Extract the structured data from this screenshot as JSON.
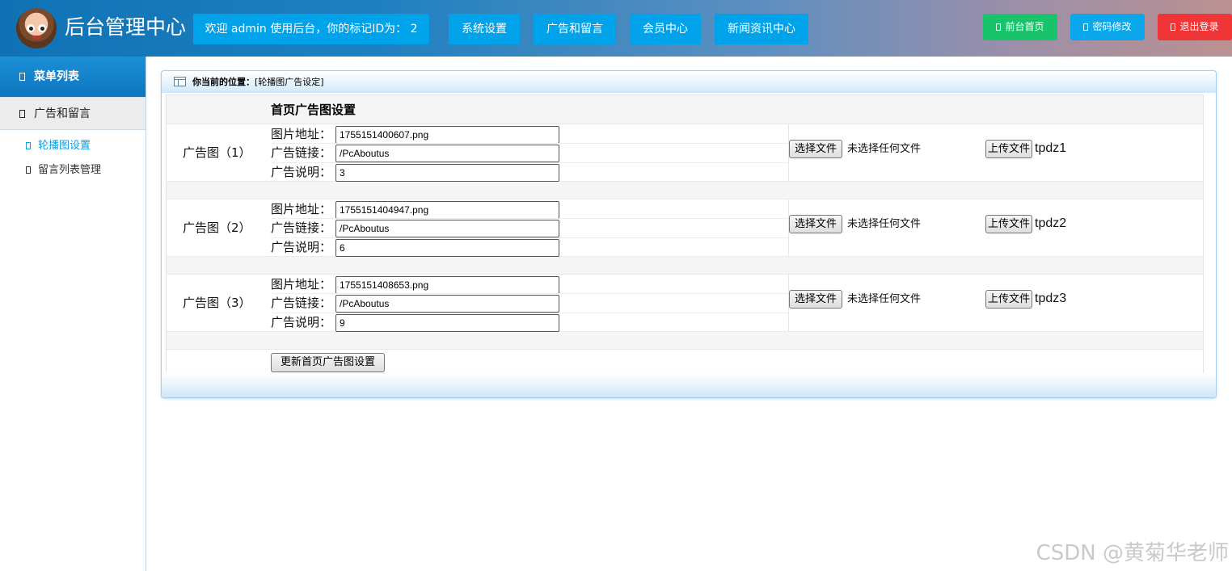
{
  "header": {
    "site_title": "后台管理中心",
    "welcome": "欢迎 admin 使用后台，你的标记ID为：  2",
    "nav": [
      "系统设置",
      "广告和留言",
      "会员中心",
      "新闻资讯中心"
    ],
    "top_buttons": {
      "home": "前台首页",
      "password": "密码修改",
      "logout": "退出登录"
    }
  },
  "sidebar": {
    "menu_title": "菜单列表",
    "group": "广告和留言",
    "items": [
      {
        "label": "轮播图设置",
        "active": true
      },
      {
        "label": "留言列表管理",
        "active": false
      }
    ]
  },
  "breadcrumb": {
    "label": "你当前的位置：",
    "value": "[轮播图广告设定]"
  },
  "form": {
    "title": "首页广告图设置",
    "field_labels": {
      "image": "图片地址：",
      "link": "广告链接：",
      "desc": "广告说明："
    },
    "choose_file": "选择文件",
    "no_file": "未选择任何文件",
    "upload": "上传文件",
    "ads": [
      {
        "label": "广告图（1）",
        "image": "1755151400607.png",
        "link": "/PcAboutus",
        "desc": "3",
        "tag": "tpdz1"
      },
      {
        "label": "广告图（2）",
        "image": "1755151404947.png",
        "link": "/PcAboutus",
        "desc": "6",
        "tag": "tpdz2"
      },
      {
        "label": "广告图（3）",
        "image": "1755151408653.png",
        "link": "/PcAboutus",
        "desc": "9",
        "tag": "tpdz3"
      }
    ],
    "submit": "更新首页广告图设置"
  },
  "watermark": "CSDN @黄菊华老师",
  "colors": {
    "nav_button": "#00a3e9",
    "home_button": "#19c36b",
    "password_button": "#0aa8ea",
    "logout_button": "#ef3535",
    "active_menu": "#0f9ce0"
  }
}
